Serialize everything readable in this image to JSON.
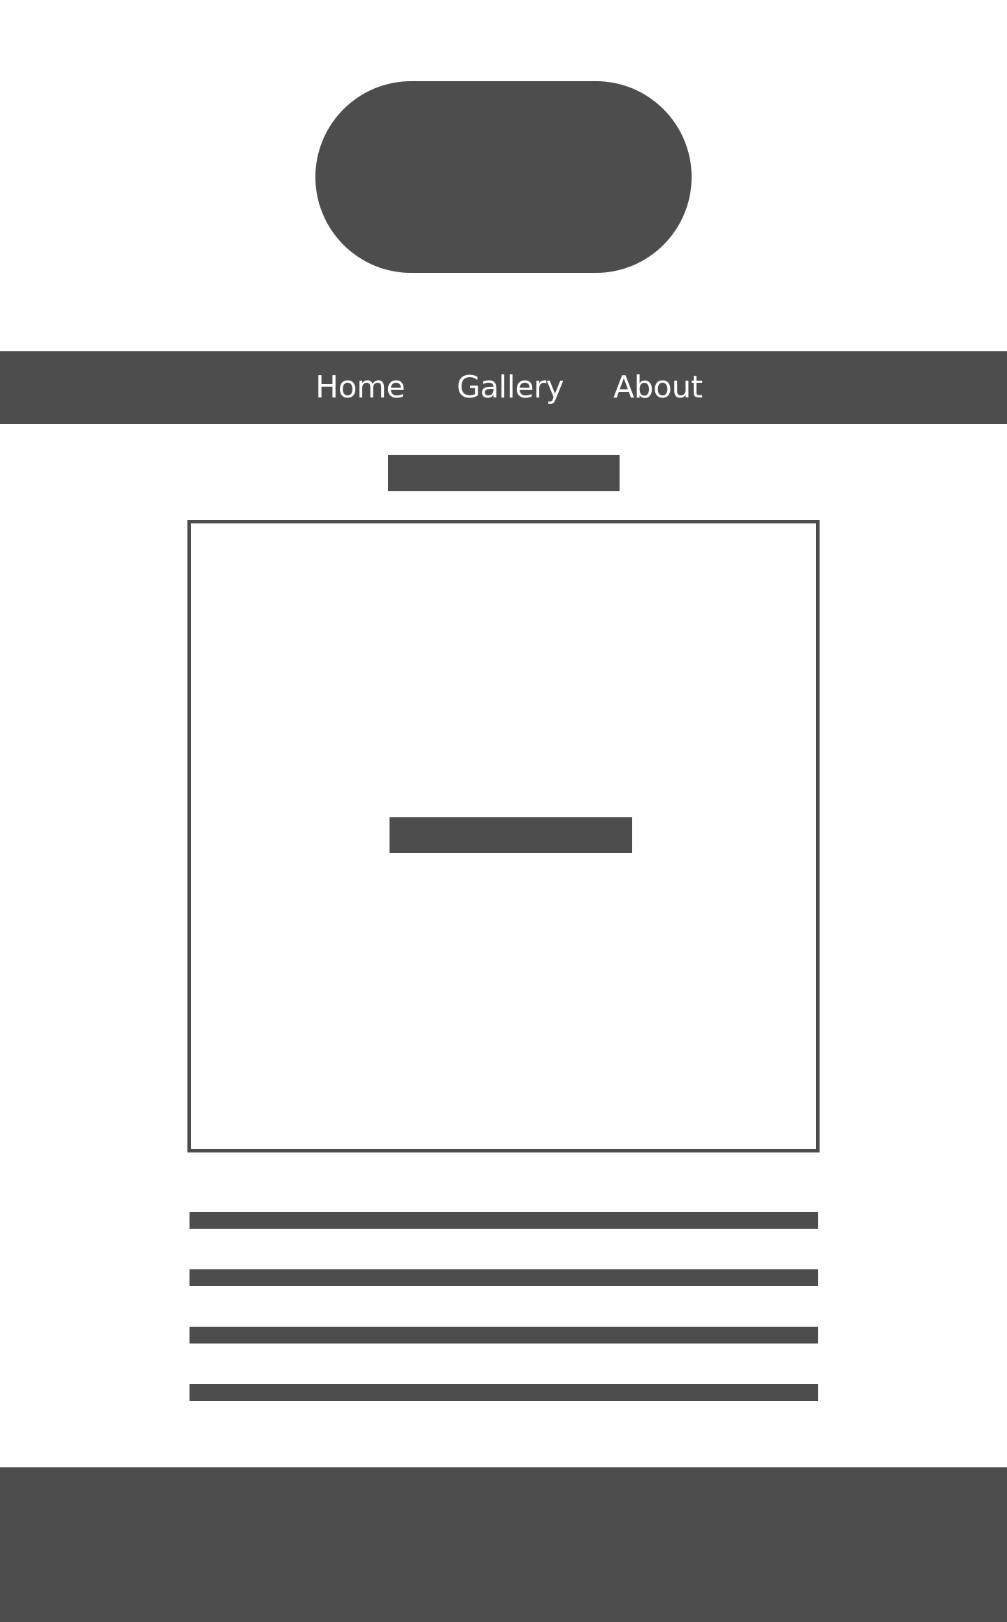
{
  "colors": {
    "placeholder": "#4d4d4d",
    "background": "#fefefe",
    "nav_text": "#ffffff"
  },
  "nav": {
    "items": [
      {
        "label": "Home"
      },
      {
        "label": "Gallery"
      },
      {
        "label": "About"
      }
    ]
  }
}
